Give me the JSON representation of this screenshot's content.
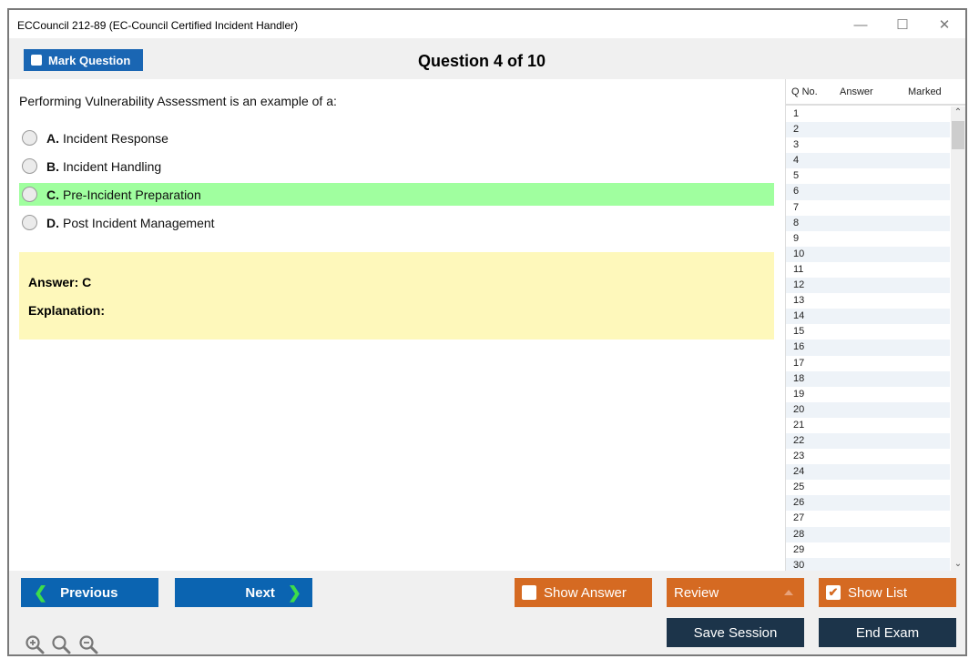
{
  "window": {
    "title": "ECCouncil 212-89 (EC-Council Certified Incident Handler)",
    "controls": {
      "minimize": "—",
      "maximize": "☐",
      "close": "✕"
    }
  },
  "header": {
    "mark_label": "Mark Question",
    "question_counter": "Question 4 of 10"
  },
  "question": {
    "text": "Performing Vulnerability Assessment is an example of a:",
    "options": [
      {
        "letter": "A.",
        "text": "Incident Response",
        "correct": false
      },
      {
        "letter": "B.",
        "text": "Incident Handling",
        "correct": false
      },
      {
        "letter": "C.",
        "text": "Pre-Incident Preparation",
        "correct": true
      },
      {
        "letter": "D.",
        "text": "Post Incident Management",
        "correct": false
      }
    ],
    "answer_label": "Answer: C",
    "explanation_label": "Explanation:",
    "correct_color": "#a0ff9f",
    "answer_bg_color": "#fef8bb"
  },
  "question_list": {
    "columns": [
      "Q No.",
      "Answer",
      "Marked"
    ],
    "rows": [
      "1",
      "2",
      "3",
      "4",
      "5",
      "6",
      "7",
      "8",
      "9",
      "10",
      "11",
      "12",
      "13",
      "14",
      "15",
      "16",
      "17",
      "18",
      "19",
      "20",
      "21",
      "22",
      "23",
      "24",
      "25",
      "26",
      "27",
      "28",
      "29",
      "30"
    ]
  },
  "footer": {
    "previous_label": "Previous",
    "next_label": "Next",
    "show_answer_label": "Show Answer",
    "show_answer_checked": false,
    "review_label": "Review",
    "show_list_label": "Show List",
    "show_list_checked": true,
    "save_session_label": "Save Session",
    "end_exam_label": "End Exam",
    "zoom_icons": [
      "zoom-in-icon",
      "zoom-reset-icon",
      "zoom-out-icon"
    ]
  },
  "colors": {
    "primary_blue": "#0b64b1",
    "orange": "#d56a22",
    "navy": "#1c344a",
    "chevron_green": "#3ddc4b"
  }
}
